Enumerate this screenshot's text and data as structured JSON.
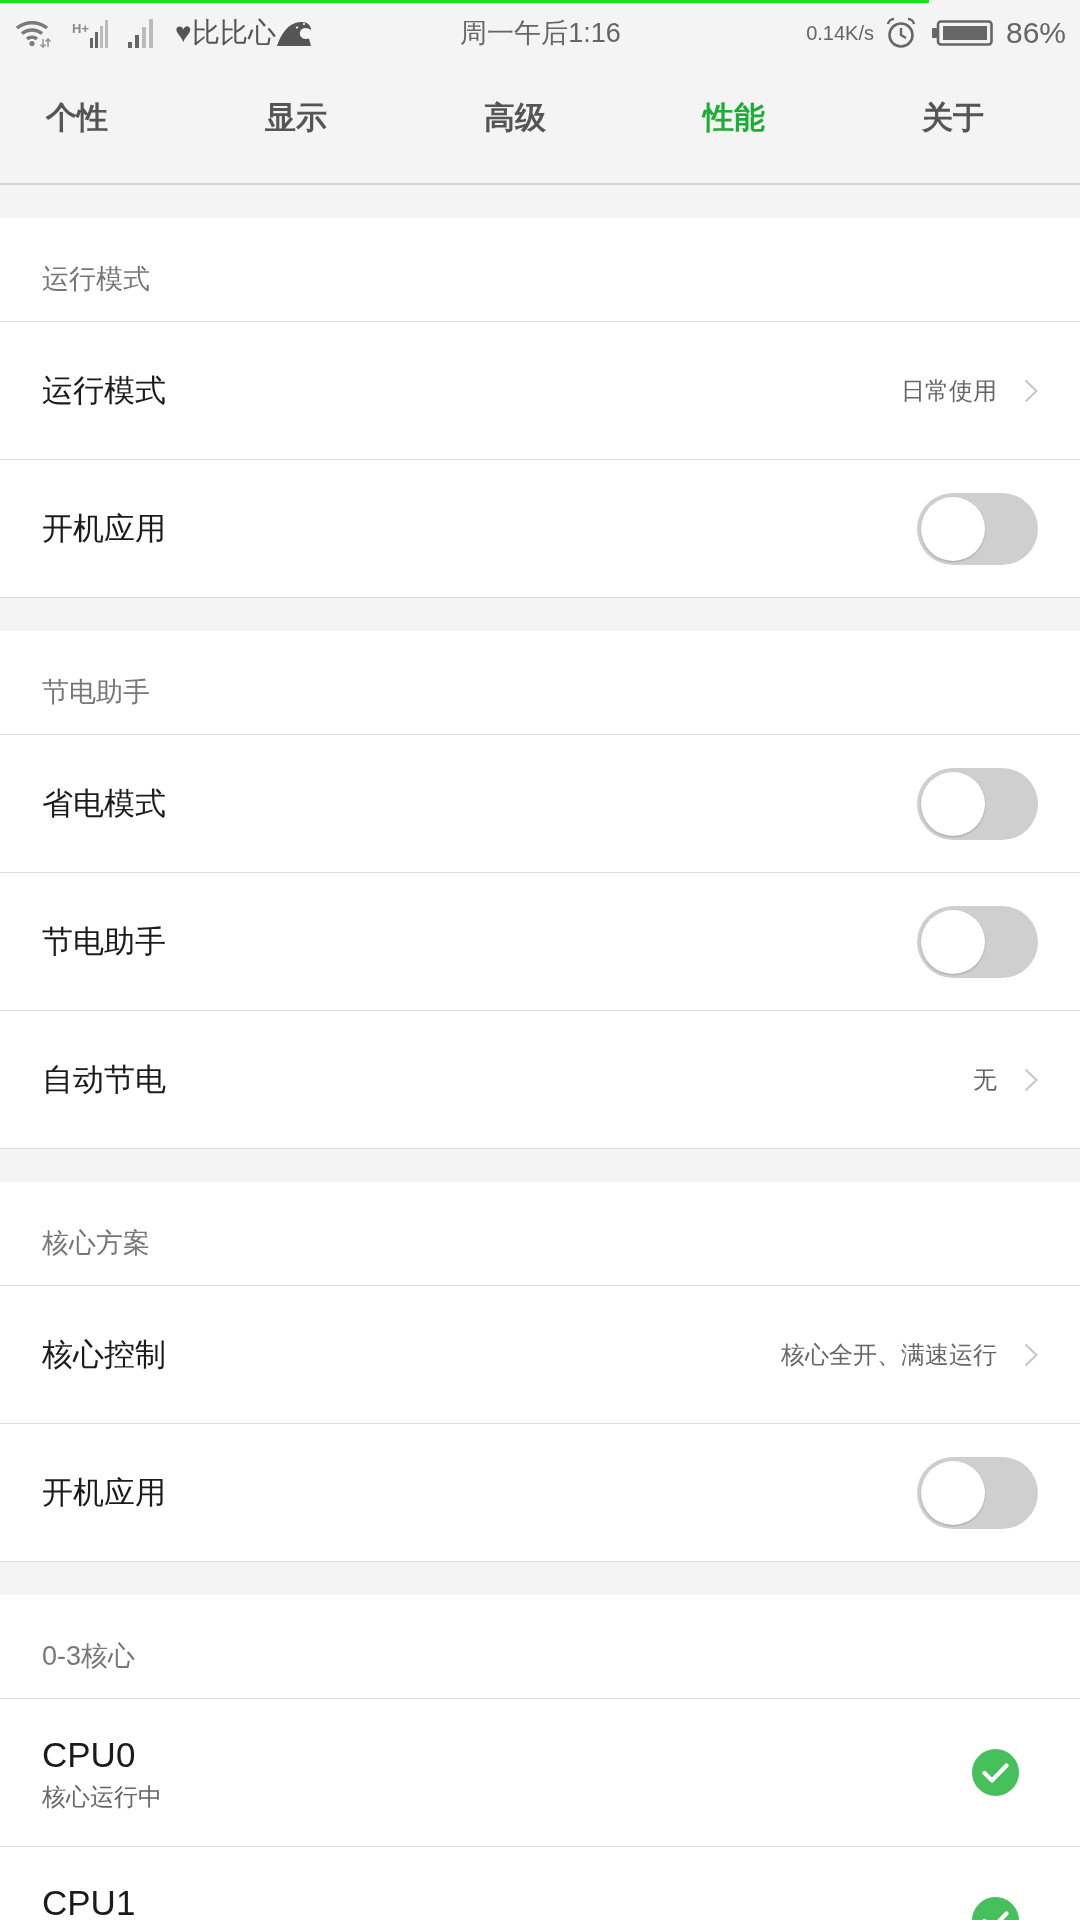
{
  "status_bar": {
    "top_line": {
      "level": 0.86
    },
    "network_type": "H+",
    "carrier": "♥比比心",
    "time": "周一午后1:16",
    "speed": "0.14K/s",
    "battery": "86%"
  },
  "tabs": [
    {
      "label": "个性",
      "selected": false
    },
    {
      "label": "显示",
      "selected": false
    },
    {
      "label": "高级",
      "selected": false
    },
    {
      "label": "性能",
      "selected": true
    },
    {
      "label": "关于",
      "selected": false
    }
  ],
  "sections": [
    {
      "title": "运行模式",
      "rows": [
        {
          "kind": "link",
          "label": "运行模式",
          "value": "日常使用"
        },
        {
          "kind": "toggle",
          "label": "开机应用",
          "on": false
        }
      ]
    },
    {
      "title": "节电助手",
      "rows": [
        {
          "kind": "toggle",
          "label": "省电模式",
          "on": false
        },
        {
          "kind": "toggle",
          "label": "节电助手",
          "on": false
        },
        {
          "kind": "link",
          "label": "自动节电",
          "value": "无"
        }
      ]
    },
    {
      "title": "核心方案",
      "rows": [
        {
          "kind": "link",
          "label": "核心控制",
          "value": "核心全开、满速运行"
        },
        {
          "kind": "toggle",
          "label": "开机应用",
          "on": false
        }
      ]
    },
    {
      "title": "0-3核心",
      "rows": [
        {
          "kind": "cpu",
          "label": "CPU0",
          "status": "核心运行中",
          "checked": true
        },
        {
          "kind": "cpu",
          "label": "CPU1",
          "checked": true
        }
      ]
    }
  ]
}
